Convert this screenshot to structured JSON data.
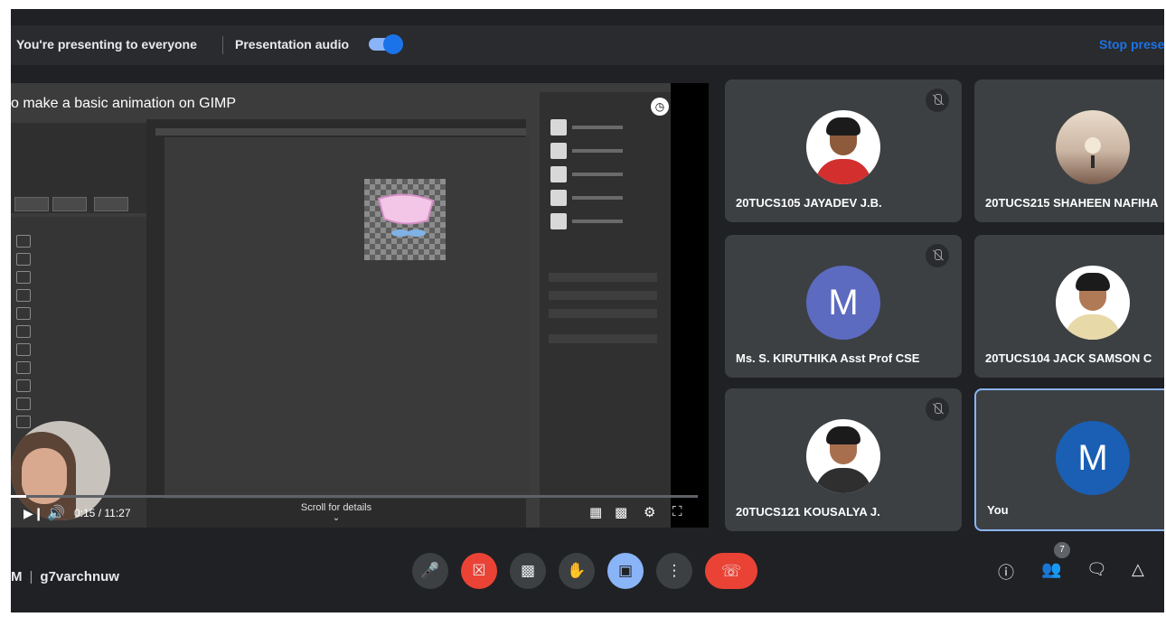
{
  "presenting_bar": {
    "presenting_text": "You're presenting to everyone",
    "audio_label": "Presentation audio",
    "audio_enabled": true,
    "stop_label": "Stop prese"
  },
  "video": {
    "title": "o make a basic animation on GIMP",
    "time": "0:15 / 11:27",
    "progress_fraction": 0.022,
    "scroll_hint": "Scroll for details",
    "icons": [
      "play-icon",
      "volume-icon",
      "clock-icon",
      "share-icon",
      "miniplayer-icon",
      "captions-icon",
      "settings-icon",
      "fullscreen-icon"
    ]
  },
  "participants": [
    {
      "name": "20TUCS105 JAYADEV J.B.",
      "avatar": "photo",
      "muted": true
    },
    {
      "name": "20TUCS215 SHAHEEN NAFIHA",
      "avatar": "landscape",
      "muted": false
    },
    {
      "name": "Ms. S. KIRUTHIKA Asst Prof CSE",
      "avatar": "M",
      "muted": true
    },
    {
      "name": "20TUCS104 JACK SAMSON C",
      "avatar": "photo",
      "muted": false
    },
    {
      "name": "20TUCS121 KOUSALYA J.",
      "avatar": "photo",
      "muted": true
    },
    {
      "name": "You",
      "avatar": "M",
      "muted": false,
      "active": true
    }
  ],
  "bottom_bar": {
    "meeting_prefix": "M",
    "meeting_code": "g7varchnuw",
    "participant_count": "7",
    "controls": [
      "mic-icon",
      "camera-off-icon",
      "captions-icon",
      "raise-hand-icon",
      "present-icon",
      "more-icon",
      "end-call-icon"
    ],
    "right_icons": [
      "info-icon",
      "people-icon",
      "chat-icon",
      "activities-icon"
    ]
  },
  "colors": {
    "background": "#202124",
    "accent_blue": "#8ab4f8",
    "link_blue": "#1a73e8",
    "danger_red": "#ea4335",
    "tile": "#3c4043"
  }
}
